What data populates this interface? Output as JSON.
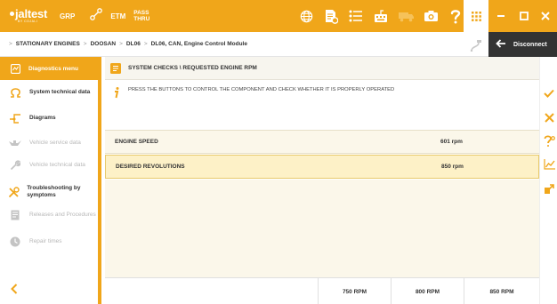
{
  "app": {
    "logo_text": "jaltest",
    "logo_sub": "BY COJALI"
  },
  "topbar": {
    "grp_label": "GRP",
    "etm_label": "ETM",
    "pass_line1": "PASS",
    "pass_line2": "THRU",
    "icons": [
      "globe-icon",
      "document-settings-icon",
      "list-icon",
      "keyboard-icon",
      "truck-icon",
      "camera-icon",
      "help-icon"
    ],
    "window_controls": [
      "grid-icon",
      "minimize-icon",
      "maximize-icon",
      "close-icon"
    ]
  },
  "breadcrumb": {
    "items": [
      "STATIONARY ENGINES",
      "DOOSAN",
      "DL06",
      "DL06, CAN, Engine Control Module"
    ],
    "separator": ">"
  },
  "disconnect": {
    "label": "Disconnect"
  },
  "sidebar": {
    "header": "Diagnostics menu",
    "items": [
      {
        "label": "System technical data",
        "icon": "ohm-icon",
        "enabled": true
      },
      {
        "label": "Diagrams",
        "icon": "diagram-icon",
        "enabled": true
      },
      {
        "label": "Vehicle service data",
        "icon": "oil-can-icon",
        "enabled": false
      },
      {
        "label": "Vehicle technical data",
        "icon": "wrench-icon",
        "enabled": false
      },
      {
        "label": "Troubleshooting by symptoms",
        "icon": "tools-icon",
        "enabled": true
      },
      {
        "label": "Releases and Procedures",
        "icon": "document-icon",
        "enabled": false
      },
      {
        "label": "Repair times",
        "icon": "clock-icon",
        "enabled": false
      }
    ]
  },
  "main": {
    "title": "SYSTEM CHECKS \\ REQUESTED ENGINE RPM",
    "info": "PRESS THE BUTTONS TO CONTROL THE COMPONENT AND CHECK WHETHER IT IS PROPERLY OPERATED",
    "params": [
      {
        "name": "ENGINE SPEED",
        "value": "601 rpm"
      },
      {
        "name": "DESIRED REVOLUTIONS",
        "value": "850 rpm"
      }
    ],
    "buttons": [
      "750 RPM",
      "800 RPM",
      "850 RPM"
    ]
  },
  "right_toolbar": {
    "icons": [
      "check-icon",
      "cancel-icon",
      "help-settings-icon",
      "chart-icon",
      "export-icon"
    ]
  },
  "colors": {
    "accent": "#f0a61a",
    "dark": "#333333",
    "row_highlight": "#fdf1c7"
  }
}
